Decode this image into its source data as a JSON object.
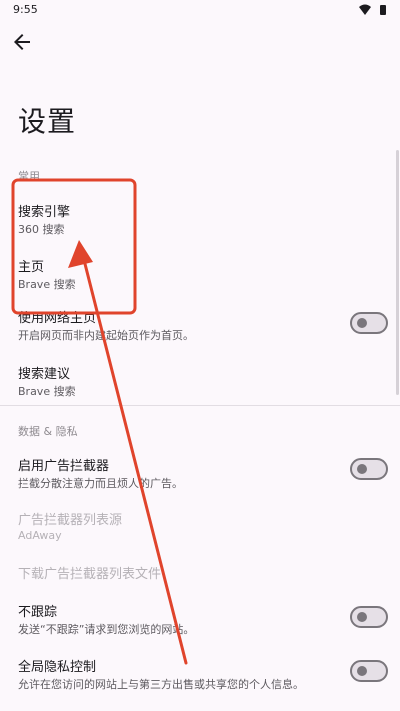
{
  "status": {
    "time": "9:55"
  },
  "page": {
    "title": "设置"
  },
  "sections": {
    "general": "常用",
    "privacy": "数据 & 隐私"
  },
  "items": {
    "search_engine": {
      "title": "搜索引擎",
      "subtitle": "360 搜索"
    },
    "homepage": {
      "title": "主页",
      "subtitle": "Brave 搜索"
    },
    "use_web_homepage": {
      "title": "使用网络主页",
      "subtitle": "开启网页而非内建起始页作为首页。",
      "enabled": false
    },
    "search_suggestions": {
      "title": "搜索建议",
      "subtitle": "Brave 搜索"
    },
    "ad_blocker": {
      "title": "启用广告拦截器",
      "subtitle": "拦截分散注意力而且烦人的广告。",
      "enabled": false
    },
    "ad_blocker_source": {
      "title": "广告拦截器列表源",
      "subtitle": "AdAway"
    },
    "download_ad_list": {
      "title": "下载广告拦截器列表文件"
    },
    "do_not_track": {
      "title": "不跟踪",
      "subtitle": "发送“不跟踪”请求到您浏览的网站。",
      "enabled": false
    },
    "global_privacy": {
      "title": "全局隐私控制",
      "subtitle": "允许在您访问的网站上与第三方出售或共享您的个人信息。",
      "enabled": false
    }
  },
  "colors": {
    "annotation": "#e0442c",
    "background": "#fcf8fc",
    "toggle_off": "#e6e0e7"
  },
  "icons": {
    "back": "arrow-back-icon",
    "wifi": "wifi-icon",
    "battery": "battery-icon"
  }
}
